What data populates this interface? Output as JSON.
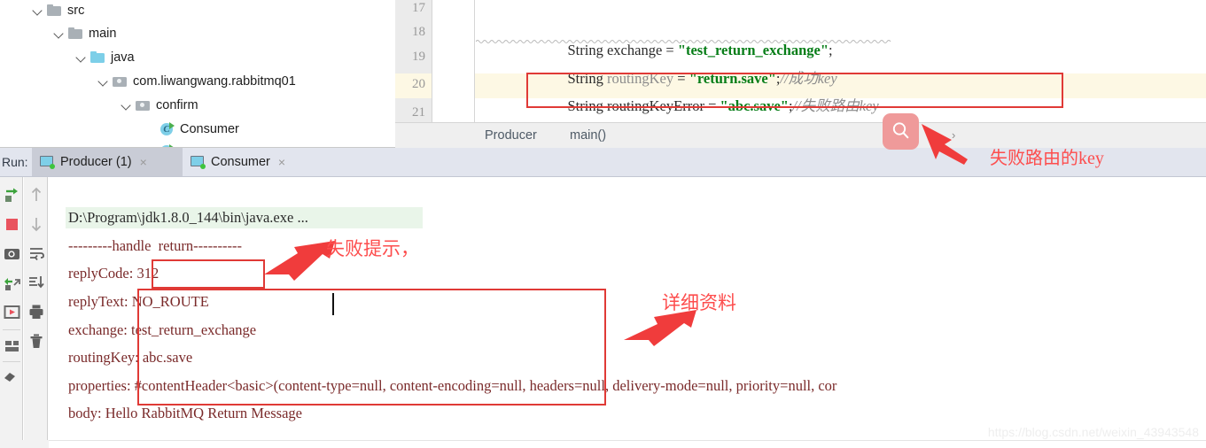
{
  "project_tree": {
    "rows": [
      {
        "label": "src",
        "icon": "folder-grey-icon",
        "indent": 0,
        "chevron": true
      },
      {
        "label": "main",
        "icon": "folder-grey-icon",
        "indent": 1,
        "chevron": true
      },
      {
        "label": "java",
        "icon": "folder-blue-icon",
        "indent": 2,
        "chevron": true
      },
      {
        "label": "com.liwangwang.rabbitmq01",
        "icon": "package-icon",
        "indent": 3,
        "chevron": true
      },
      {
        "label": "confirm",
        "icon": "package-icon",
        "indent": 4,
        "chevron": true
      },
      {
        "label": "Consumer",
        "icon": "java-class-icon",
        "indent": 5,
        "chevron": false
      }
    ]
  },
  "editor": {
    "line_numbers": [
      "17",
      "18",
      "19",
      "20",
      "21"
    ],
    "highlighted_line": "20",
    "lines": [
      {
        "num": "17",
        "tokens": []
      },
      {
        "num": "18",
        "tokens": [
          {
            "t": "String ",
            "c": "kw"
          },
          {
            "t": "exchange",
            "c": "kw"
          },
          {
            "t": " = ",
            "c": "punct"
          },
          {
            "t": "\"test_return_exchange\"",
            "c": "str"
          },
          {
            "t": ";",
            "c": "punct"
          }
        ]
      },
      {
        "num": "19",
        "tokens": [
          {
            "t": "String ",
            "c": "kw"
          },
          {
            "t": "routingKey",
            "c": "fld"
          },
          {
            "t": " = ",
            "c": "punct"
          },
          {
            "t": "\"return.save\"",
            "c": "str"
          },
          {
            "t": ";",
            "c": "punct"
          },
          {
            "t": "//成功key",
            "c": "cmt"
          }
        ]
      },
      {
        "num": "20",
        "tokens": [
          {
            "t": "String ",
            "c": "kw"
          },
          {
            "t": "routingKeyError",
            "c": "kw"
          },
          {
            "t": " = ",
            "c": "punct"
          },
          {
            "t": "\"abc.save\"",
            "c": "str"
          },
          {
            "t": ";",
            "c": "punct"
          },
          {
            "t": "//失败路由key",
            "c": "cmt"
          }
        ]
      },
      {
        "num": "21",
        "tokens": []
      }
    ],
    "breadcrumb": {
      "items": [
        "Producer",
        "main()"
      ],
      "separator": "›"
    },
    "search_icon": "search-icon"
  },
  "run_window": {
    "label": "Run:",
    "tabs": [
      {
        "label": "Producer (1)",
        "selected": true,
        "close": "×",
        "icon": "run-config-icon"
      },
      {
        "label": "Consumer",
        "selected": false,
        "close": "×",
        "icon": "run-config-icon"
      }
    ],
    "toolbar_left": [
      "rerun-icon",
      "stop-icon",
      "dump-threads-icon",
      "restore-layout-icon",
      "resume-program-icon",
      "separator",
      "layout-settings-icon",
      "separator",
      "pin-tab-icon"
    ],
    "toolbar_right": [
      "arrow-up-icon",
      "arrow-down-icon",
      "soft-wrap-icon",
      "scroll-to-end-icon",
      "print-icon",
      "trash-icon"
    ],
    "console": {
      "command_line": "D:\\Program\\jdk1.8.0_144\\bin\\java.exe ...",
      "lines": [
        "---------handle  return----------",
        "replyCode: 312",
        "replyText: NO_ROUTE",
        "exchange: test_return_exchange",
        "routingKey: abc.save",
        "properties: #contentHeader<basic>(content-type=null, content-encoding=null, headers=null, delivery-mode=null, priority=null, cor",
        "body: Hello RabbitMQ Return Message"
      ]
    }
  },
  "annotations": [
    {
      "name": "failure-routing-key-note",
      "text": "失败路由的key"
    },
    {
      "name": "failure-hint-note",
      "text": "失败提示，"
    },
    {
      "name": "detail-info-note",
      "text": "详细资料"
    }
  ],
  "watermark": "https://blog.csdn.net/weixin_43943548",
  "colors": {
    "annotation_red": "#fd4d4d",
    "box_red": "#e03a36",
    "string_green": "#067d17",
    "line_highlight": "#fdf8e4",
    "console_text": "#7a2a2a",
    "tab_selected": "#c9ccd6"
  }
}
